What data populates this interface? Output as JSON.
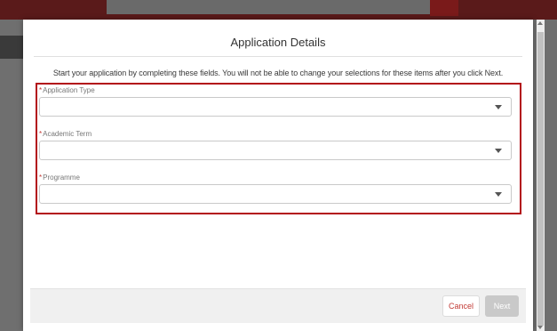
{
  "modal": {
    "title": "Application Details",
    "intro": "Start your application by completing these fields. You will not be able to change your selections for these items after you click Next.",
    "required_mark": "*",
    "fields": [
      {
        "label": "Application Type",
        "value": ""
      },
      {
        "label": "Academic Term",
        "value": ""
      },
      {
        "label": "Programme",
        "value": ""
      }
    ],
    "cancel_label": "Cancel",
    "next_label": "Next"
  },
  "colors": {
    "highlight_border": "#b30e18",
    "required": "#c23934",
    "next_disabled": "#c9c9c9"
  }
}
